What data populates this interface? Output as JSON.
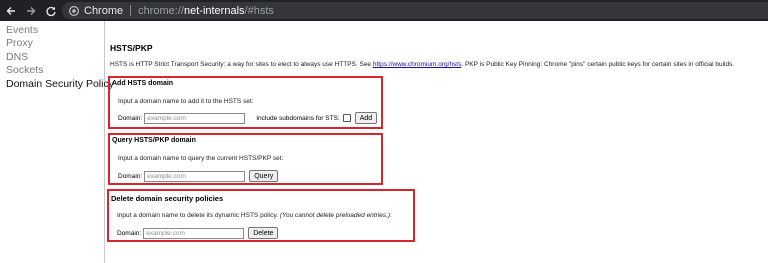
{
  "browser": {
    "site_chip": "Chrome",
    "url_scheme": "chrome://",
    "url_host": "net-internals",
    "url_path": "/#hsts",
    "colors": {
      "topbar": "#202124",
      "omnibox": "#35363a"
    }
  },
  "sidebar": {
    "items": [
      {
        "label": "Events"
      },
      {
        "label": "Proxy"
      },
      {
        "label": "DNS"
      },
      {
        "label": "Sockets"
      },
      {
        "label": "Domain Security Policy",
        "active": true
      }
    ]
  },
  "main": {
    "title": "HSTS/PKP",
    "intro_before": "HSTS is HTTP Strict Transport Security: a way for sites to elect to always use HTTPS. See ",
    "intro_link": "https://www.chromium.org/hsts",
    "intro_after": ". PKP is Public Key Pinning: Chrome \"pins\" certain public keys for certain sites in official builds."
  },
  "add": {
    "title": "Add HSTS domain",
    "description": "Input a domain name to add it to the HSTS set:",
    "domain_label": "Domain:",
    "placeholder": "example.com",
    "subdomains_label": "Include subdomains for STS:",
    "subdomains_checked": false,
    "button": "Add"
  },
  "query": {
    "title": "Query HSTS/PKP domain",
    "description": "Input a domain name to query the current HSTS/PKP set:",
    "domain_label": "Domain:",
    "placeholder": "example.com",
    "button": "Query"
  },
  "delete": {
    "title": "Delete domain security policies",
    "description": "Input a domain name to delete its dynamic HSTS policy. ",
    "description_note": "(You cannot delete preloaded entries.)",
    "description_end": ":",
    "domain_label": "Domain:",
    "placeholder": "example.com",
    "button": "Delete"
  },
  "accent": {
    "highlight_border": "#d9262e",
    "link": "#1a0dab"
  }
}
